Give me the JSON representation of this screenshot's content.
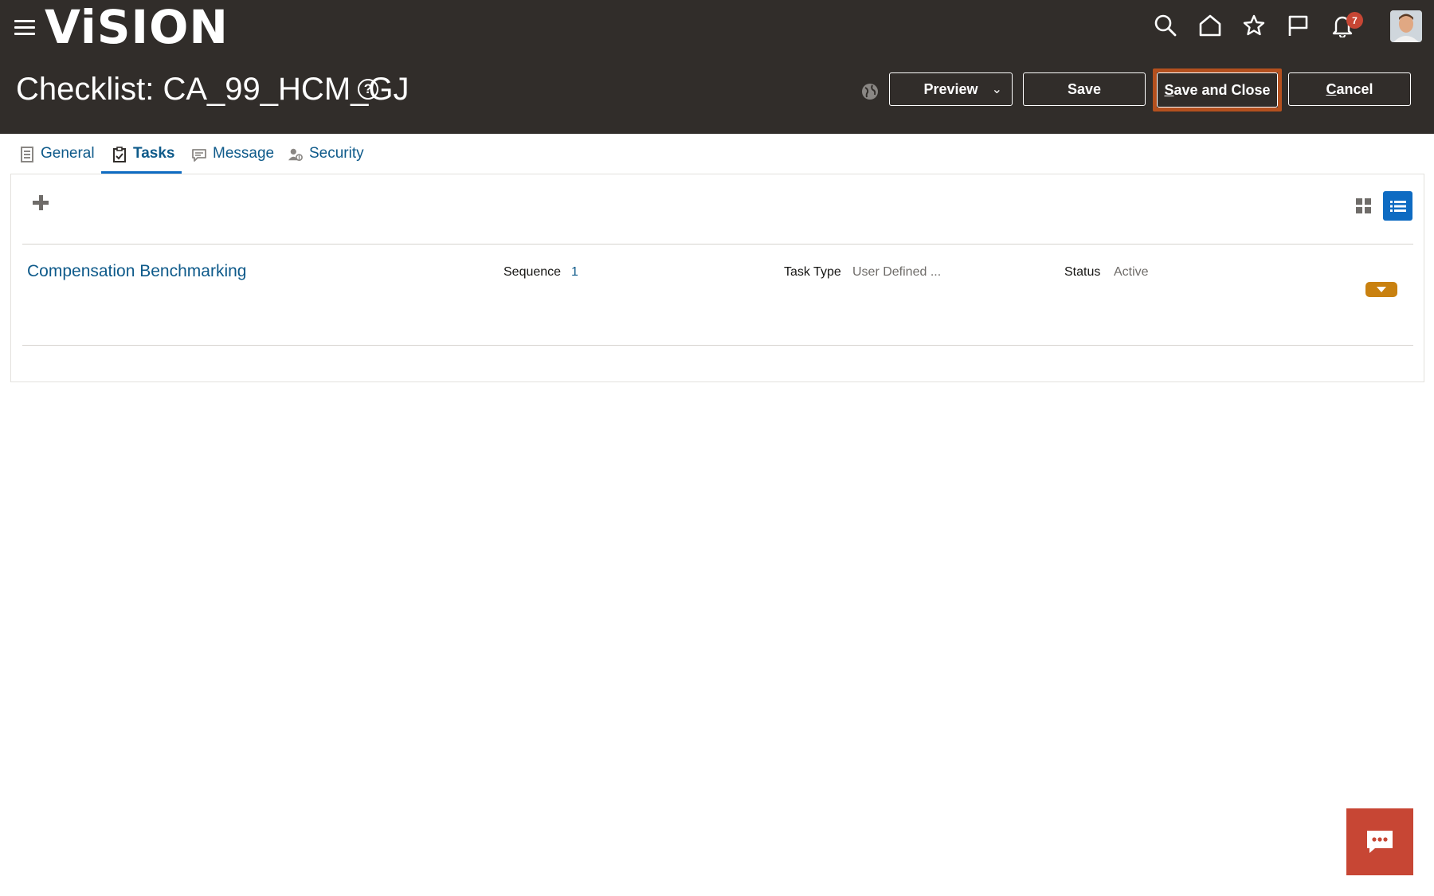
{
  "header": {
    "logo": "ViSION",
    "notification_count": "7",
    "page_title": "Checklist: CA_99_HCM_GJ",
    "help_glyph": "?",
    "buttons": {
      "preview": "Preview",
      "save": "Save",
      "save_and_close_prefix": "S",
      "save_and_close_rest": "ave and Close",
      "cancel_prefix": "C",
      "cancel_rest": "ancel"
    }
  },
  "icons": {
    "menu": "hamburger-menu-icon",
    "search": "search-icon",
    "home": "home-icon",
    "favorites": "star-icon",
    "watchlist": "flag-icon",
    "notifications": "bell-icon",
    "language": "globe-icon",
    "add": "plus-icon",
    "grid_view": "grid-view-icon",
    "list_view": "list-view-icon",
    "chat": "chat-icon"
  },
  "tabs": [
    {
      "label": "General",
      "icon": "document-icon",
      "active": false
    },
    {
      "label": "Tasks",
      "icon": "clipboard-check-icon",
      "active": true
    },
    {
      "label": "Message",
      "icon": "message-icon",
      "active": false
    },
    {
      "label": "Security",
      "icon": "security-users-icon",
      "active": false
    }
  ],
  "tasks": [
    {
      "title": "Compensation Benchmarking",
      "sequence_label": "Sequence",
      "sequence_value": "1",
      "task_type_label": "Task Type",
      "task_type_value": "User Defined ...",
      "status_label": "Status",
      "status_value": "Active"
    }
  ],
  "colors": {
    "header_bg": "#312d2a",
    "link": "#0e5a8a",
    "accent_blue": "#0e6bc2",
    "highlight_border": "#b4501e",
    "row_action": "#c98110",
    "chat_bg": "#c74634"
  }
}
